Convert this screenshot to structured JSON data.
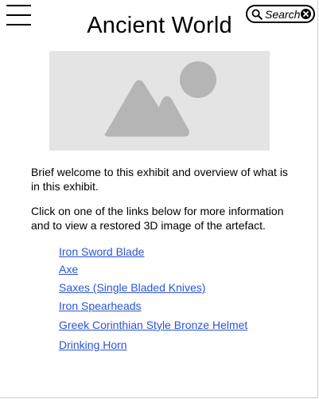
{
  "header": {
    "title": "Ancient World",
    "menu_icon": "hamburger-menu-icon",
    "search": {
      "label": "Search",
      "icon": "search-icon",
      "clear_icon": "clear-search-icon"
    }
  },
  "hero": {
    "icon": "image-placeholder-icon"
  },
  "intro": {
    "welcome": "Brief welcome to this exhibit and overview of what is in this exhibit.",
    "instructions": "Click on one of the links below for more information and to view a restored 3D image of the artefact."
  },
  "artefacts": [
    {
      "label": "Iron Sword Blade"
    },
    {
      "label": "Axe"
    },
    {
      "label": "Saxes (Single Bladed Knives)"
    },
    {
      "label": "Iron Spearheads"
    },
    {
      "label": "Greek Corinthian Style Bronze Helmet"
    },
    {
      "label": "Drinking Horn"
    }
  ],
  "colors": {
    "link": "#2a55d2",
    "placeholder_bg": "#e4e4e4",
    "placeholder_shape": "#b5b5b5"
  }
}
